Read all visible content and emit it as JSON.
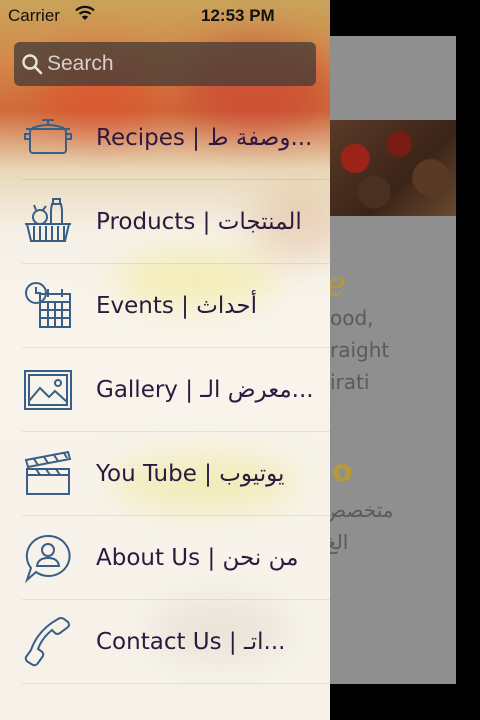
{
  "status_bar": {
    "carrier": "Carrier",
    "time": "12:53 PM"
  },
  "search": {
    "placeholder": "Search"
  },
  "menu": {
    "items": [
      {
        "label": "Recipes | وصفة ط...",
        "icon": "pot-icon"
      },
      {
        "label": "Products | المنتجات",
        "icon": "basket-icon"
      },
      {
        "label": "Events | أحداث",
        "icon": "calendar-icon"
      },
      {
        "label": "Gallery | معرض الـ...",
        "icon": "image-icon"
      },
      {
        "label": "You Tube | يوتيوب",
        "icon": "clapperboard-icon"
      },
      {
        "label": "About Us | من نحن",
        "icon": "person-bubble-icon"
      },
      {
        "label": "Contact Us | اتـ...",
        "icon": "phone-icon"
      }
    ]
  },
  "background": {
    "lines": [
      "ood,",
      "raight",
      "irati",
      "متخصص",
      "الغ"
    ]
  },
  "colors": {
    "menu_text": "#2d1940",
    "icon_stroke": "#3a5f86",
    "search_bg": "#463c37"
  }
}
